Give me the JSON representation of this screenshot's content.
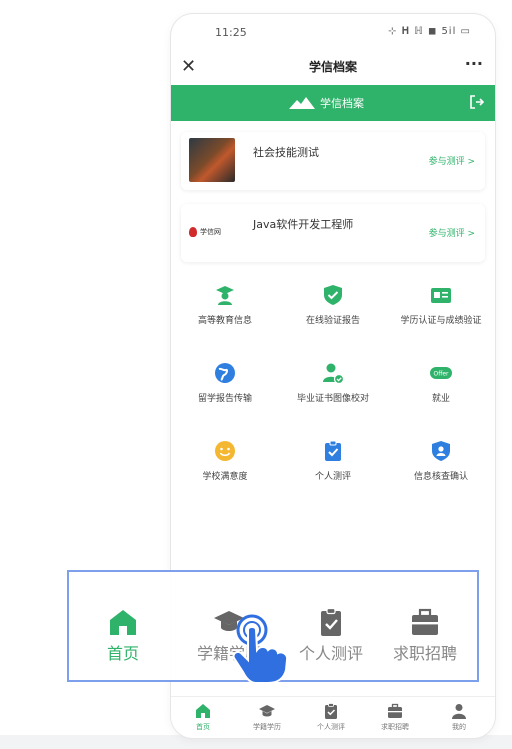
{
  "colors": {
    "accent": "#2fb36a",
    "zoom_border": "#7ea0ec",
    "link": "#2fb36a",
    "blue": "#2f7fe0",
    "yellow": "#f4b731"
  },
  "status_bar": {
    "time": "11:25",
    "icons": "⊹ 𝐇 ℍ ◼ 5il ▭"
  },
  "nav": {
    "close_icon": "close-icon",
    "title": "学信档案",
    "more_icon": "more-icon"
  },
  "brand_bar": {
    "logo_text": "学信档案",
    "exit_icon": "logout-icon"
  },
  "cards": [
    {
      "name": "社会技能测试",
      "link": "参与测评 >",
      "thumb": "photo-thumbnail"
    },
    {
      "name": "Java软件开发工程师",
      "link": "参与测评 >",
      "thumb": "xuexin-logo",
      "thumb_text": "学信网"
    }
  ],
  "services": [
    {
      "label": "高等教育信息",
      "icon": "graduate-icon",
      "color": "#2fb36a"
    },
    {
      "label": "在线验证报告",
      "icon": "shield-check-icon",
      "color": "#2fb36a"
    },
    {
      "label": "学历认证与成绩验证",
      "icon": "id-card-icon",
      "color": "#2fb36a"
    },
    {
      "label": "留学报告传输",
      "icon": "globe-icon",
      "color": "#2f7fe0"
    },
    {
      "label": "毕业证书图像校对",
      "icon": "user-check-icon",
      "color": "#2fb36a"
    },
    {
      "label": "就业",
      "icon": "offer-icon",
      "color": "#2fb36a",
      "badge": "Offer"
    },
    {
      "label": "学校满意度",
      "icon": "smile-icon",
      "color": "#f4b731"
    },
    {
      "label": "个人测评",
      "icon": "clipboard-check-icon",
      "color": "#2f7fe0"
    },
    {
      "label": "信息核查确认",
      "icon": "shield-user-icon",
      "color": "#2f7fe0"
    }
  ],
  "tabbar": [
    {
      "label": "首页",
      "icon": "home-icon",
      "active": true
    },
    {
      "label": "学籍学历",
      "icon": "graduation-cap-icon",
      "active": false
    },
    {
      "label": "个人测评",
      "icon": "clipboard-check-icon",
      "active": false
    },
    {
      "label": "求职招聘",
      "icon": "briefcase-icon",
      "active": false
    },
    {
      "label": "我的",
      "icon": "person-icon",
      "active": false
    }
  ],
  "zoom_tabbar": [
    {
      "label": "首页",
      "icon": "home-icon",
      "active": true
    },
    {
      "label": "学籍学历",
      "icon": "graduation-cap-icon",
      "active": false
    },
    {
      "label": "个人测评",
      "icon": "clipboard-check-icon",
      "active": false
    },
    {
      "label": "求职招聘",
      "icon": "briefcase-icon",
      "active": false
    }
  ],
  "pointer": {
    "icon": "hand-pointer-icon"
  }
}
